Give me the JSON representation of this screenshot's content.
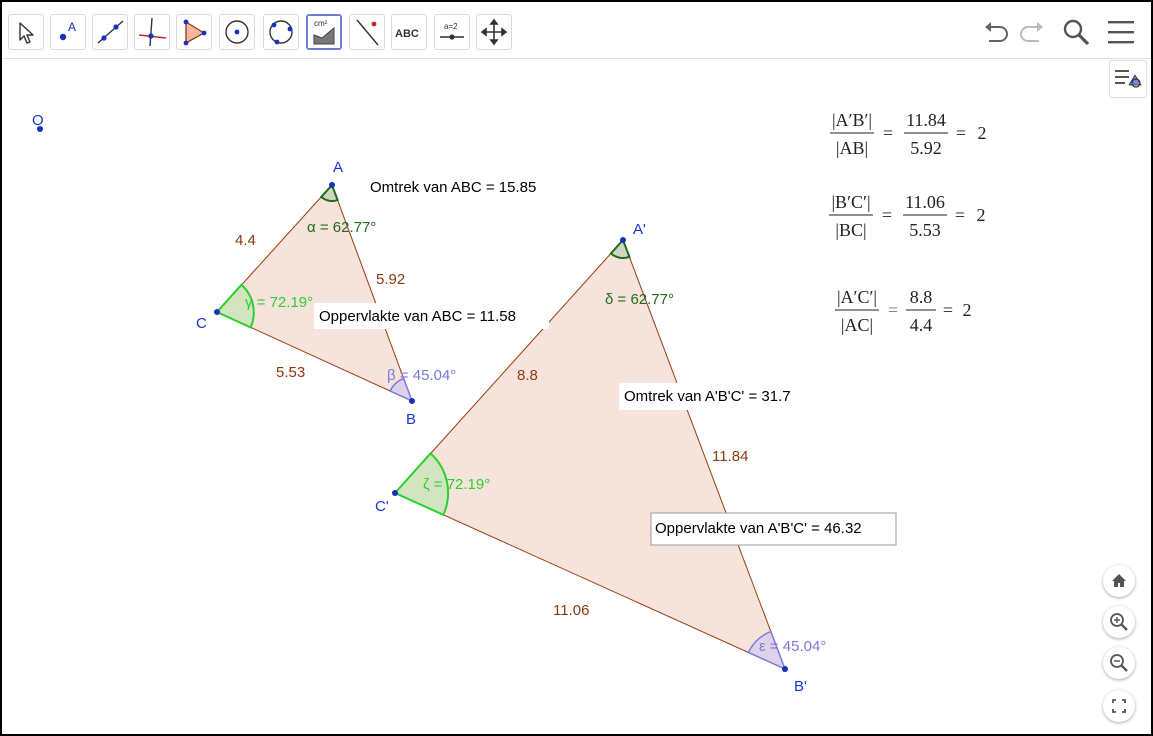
{
  "toolbar": {
    "tools": [
      {
        "name": "move-tool-icon"
      },
      {
        "name": "point-tool-icon",
        "glyph": "A"
      },
      {
        "name": "line-tool-icon"
      },
      {
        "name": "perpendicular-line-tool-icon"
      },
      {
        "name": "polygon-tool-icon"
      },
      {
        "name": "circle-tool-icon"
      },
      {
        "name": "circle-three-points-tool-icon"
      },
      {
        "name": "area-tool-icon",
        "glyph": "cm²"
      },
      {
        "name": "reflect-tool-icon"
      },
      {
        "name": "text-tool-icon",
        "glyph": "ABC"
      },
      {
        "name": "slider-tool-icon",
        "glyph": "a=2"
      },
      {
        "name": "move-graphics-view-tool-icon"
      }
    ],
    "right_icons": [
      "undo-icon",
      "redo-icon",
      "search-icon",
      "menu-icon"
    ]
  },
  "points": {
    "O": "O",
    "A": "A",
    "B": "B",
    "C": "C",
    "A1": "A'",
    "B1": "B'",
    "C1": "C'"
  },
  "sides": {
    "AC": "4.4",
    "AB": "5.92",
    "BC": "5.53",
    "A1C1": "8.8",
    "A1B1": "11.84",
    "B1C1": "11.06"
  },
  "angles": {
    "alpha": "α = 62.77°",
    "beta": "β = 45.04°",
    "gamma": "γ = 72.19°",
    "delta": "δ = 62.77°",
    "epsilon": "ε = 45.04°",
    "zeta": "ζ = 72.19°"
  },
  "texts": {
    "omtrek_abc": "Omtrek van  ABC = 15.85",
    "opp_abc": "Oppervlakte van  ABC = 11.58",
    "omtrek_a1b1c1": "Omtrek van  A'B'C' = 31.7",
    "opp_a1b1c1": "Oppervlakte van  A'B'C' = 46.32"
  },
  "ratios": [
    {
      "num_label": "|A′B′|",
      "den_label": "|AB|",
      "num_val": "11.84",
      "den_val": "5.92",
      "result": "2"
    },
    {
      "num_label": "|B′C′|",
      "den_label": "|BC|",
      "num_val": "11.06",
      "den_val": "5.53",
      "result": "2"
    },
    {
      "num_label": "|A′C′|",
      "den_label": "|AC|",
      "num_val": "8.8",
      "den_val": "4.4",
      "result": "2"
    }
  ],
  "equals": "=",
  "colors": {
    "fill": "#f6e3dc",
    "edge": "#9a3c10",
    "side_label": "#8b3a0f",
    "point": "#1a2ec0",
    "point_label": "#1a35d0",
    "angle_dark_green": "#1d6b1d",
    "angle_green": "#2ad12a",
    "angle_blue": "#7a7adf"
  },
  "zoom_controls": [
    "home-icon",
    "zoom-in-icon",
    "zoom-out-icon",
    "fullscreen-icon"
  ]
}
